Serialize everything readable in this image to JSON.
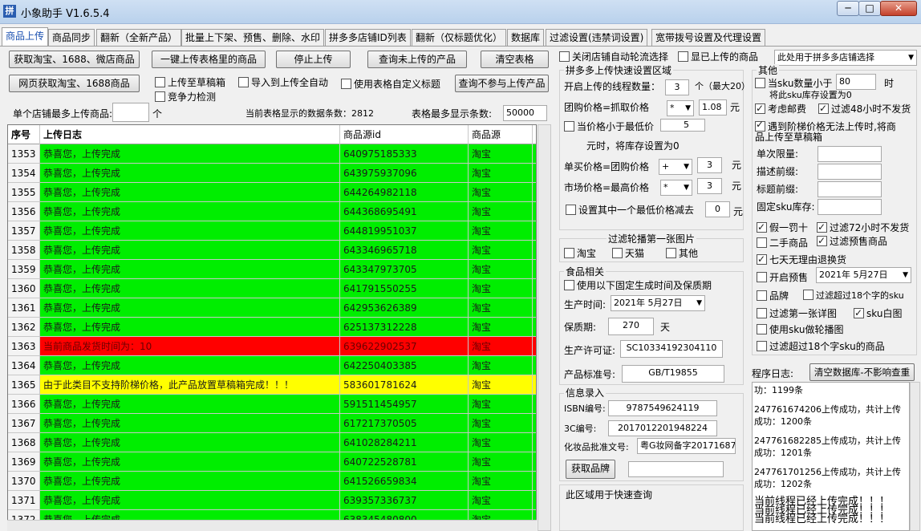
{
  "window": {
    "title": "小象助手 V1.6.5.4",
    "icon_text": "拼",
    "minimize": "─",
    "maximize": "□",
    "close": "✕"
  },
  "tabs": [
    "商品上传",
    "商品同步",
    "翻新（全新产品）",
    "批量上下架、预售、删除、水印",
    "拼多多店铺ID列表",
    "翻新（仅标题优化）",
    "数据库",
    "过滤设置(违禁词设置)",
    "宽带拨号设置及代理设置"
  ],
  "toolbar": {
    "fetch_btn": "获取淘宝、1688、微店商品",
    "upload_table_btn": "一键上传表格里的商品",
    "stop_btn": "停止上传",
    "query_btn": "查询未上传的产品",
    "clear_btn": "清空表格",
    "web_fetch_btn": "网页获取淘宝、1688商品",
    "cb_draft": "上传至草稿箱",
    "cb_import_auto": "导入到上传全自动",
    "cb_custom_title": "使用表格自定义标题",
    "query_excluded_btn": "查询不参与上传产品",
    "cb_compete": "竞争力检测",
    "max_upload_label": "单个店铺最多上传商品:",
    "max_upload_value": "",
    "max_upload_unit": "个",
    "count_label": "当前表格显示的数据条数：2812",
    "max_show_label": "表格最多显示条数:",
    "max_show_value": "50000"
  },
  "right_top": {
    "cb_close_rotate": "关闭店铺自动轮流选择",
    "cb_show_uploaded": "显已上传的商品",
    "shop_select": "此处用于拼多多店铺选择"
  },
  "grid": {
    "headers": [
      "序号",
      "上传日志",
      "商品源id",
      "商品源"
    ],
    "rows": [
      {
        "no": "1353",
        "log": "恭喜您，上传完成",
        "id": "640975185333",
        "src": "淘宝",
        "status": "green"
      },
      {
        "no": "1354",
        "log": "恭喜您，上传完成",
        "id": "643975937096",
        "src": "淘宝",
        "status": "green"
      },
      {
        "no": "1355",
        "log": "恭喜您，上传完成",
        "id": "644264982118",
        "src": "淘宝",
        "status": "green"
      },
      {
        "no": "1356",
        "log": "恭喜您，上传完成",
        "id": "644368695491",
        "src": "淘宝",
        "status": "green"
      },
      {
        "no": "1357",
        "log": "恭喜您，上传完成",
        "id": "644819951037",
        "src": "淘宝",
        "status": "green"
      },
      {
        "no": "1358",
        "log": "恭喜您，上传完成",
        "id": "643346965718",
        "src": "淘宝",
        "status": "green"
      },
      {
        "no": "1359",
        "log": "恭喜您，上传完成",
        "id": "643347973705",
        "src": "淘宝",
        "status": "green"
      },
      {
        "no": "1360",
        "log": "恭喜您，上传完成",
        "id": "641791550255",
        "src": "淘宝",
        "status": "green"
      },
      {
        "no": "1361",
        "log": "恭喜您，上传完成",
        "id": "642953626389",
        "src": "淘宝",
        "status": "green"
      },
      {
        "no": "1362",
        "log": "恭喜您，上传完成",
        "id": "625137312228",
        "src": "淘宝",
        "status": "green"
      },
      {
        "no": "1363",
        "log": "当前商品发货时间为：10",
        "id": "639622902537",
        "src": "淘宝",
        "status": "red"
      },
      {
        "no": "1364",
        "log": "恭喜您，上传完成",
        "id": "642250403385",
        "src": "淘宝",
        "status": "green"
      },
      {
        "no": "1365",
        "log": "由于此类目不支持阶梯价格，此产品放置草稿箱完成！！！",
        "id": "583601781624",
        "src": "淘宝",
        "status": "yellow"
      },
      {
        "no": "1366",
        "log": "恭喜您，上传完成",
        "id": "591511454957",
        "src": "淘宝",
        "status": "green"
      },
      {
        "no": "1367",
        "log": "恭喜您，上传完成",
        "id": "617217370505",
        "src": "淘宝",
        "status": "green"
      },
      {
        "no": "1368",
        "log": "恭喜您，上传完成",
        "id": "641028284211",
        "src": "淘宝",
        "status": "green"
      },
      {
        "no": "1369",
        "log": "恭喜您，上传完成",
        "id": "640722528781",
        "src": "淘宝",
        "status": "green"
      },
      {
        "no": "1370",
        "log": "恭喜您，上传完成",
        "id": "641526659834",
        "src": "淘宝",
        "status": "green"
      },
      {
        "no": "1371",
        "log": "恭喜您，上传完成",
        "id": "639357336737",
        "src": "淘宝",
        "status": "green"
      },
      {
        "no": "1372",
        "log": "恭喜您，上传完成",
        "id": "638345480800",
        "src": "淘宝",
        "status": "green"
      }
    ]
  },
  "quick": {
    "title": "拼多多上传快速设置区域",
    "threads_label": "开启上传的线程数量：",
    "threads_value": "3",
    "threads_hint": "个（最大20）",
    "group_price_label": "团购价格=抓取价格",
    "group_op": "*",
    "group_factor": "1.08",
    "unit_yuan": "元",
    "cb_min_price": "当价格小于最低价",
    "min_price_value": "5",
    "min_price_hint": "元时，将库存设置为0",
    "single_price_label": "单买价格=团购价格",
    "single_op": "+",
    "single_value": "3",
    "market_price_label": "市场价格=最高价格",
    "market_op": "*",
    "market_value": "3",
    "cb_reduce_low": "设置其中一个最低价格减去",
    "reduce_value": "0"
  },
  "carousel": {
    "title": "过滤轮播第一张图片",
    "taobao": "淘宝",
    "tmall": "天猫",
    "other": "其他"
  },
  "food": {
    "title": "食品相关",
    "cb_fixed": "使用以下固定生成时间及保质期",
    "prod_time_label": "生产时间:",
    "prod_time_value": "2021年 5月27日",
    "shelf_label": "保质期:",
    "shelf_value": "270",
    "shelf_unit": "天",
    "license_label": "生产许可证:",
    "license_value": "SC10334192304110",
    "standard_label": "产品标准号:",
    "standard_value": "GB/T19855"
  },
  "info": {
    "title": "信息录入",
    "isbn_label": "ISBN编号:",
    "isbn_value": "9787549624119",
    "ccc_label": "3C编号:",
    "ccc_value": "2017012201948224",
    "cosmetic_label": "化妆品批准文号:",
    "cosmetic_value": "粤G妆网备字20171687",
    "brand_btn": "获取品牌",
    "brand_value": "",
    "quick_query": "此区域用于快速查询"
  },
  "other": {
    "title": "其他",
    "cb_sku_less": "当sku数量小于",
    "sku_less_value": "80",
    "sku_less_unit": "时",
    "sku_less_hint": "将此sku库存设置为0",
    "cb_postage": "考虑邮费",
    "cb_48h": "过滤48小时不发货",
    "cb_ladder": "遇到阶梯价格无法上传时,将商品上传至草稿箱",
    "limit_label": "单次限量:",
    "desc_prefix_label": "描述前缀:",
    "title_prefix_label": "标题前缀:",
    "fixed_stock_label": "固定sku库存:",
    "cb_fake": "假一罚十",
    "cb_72h": "过滤72小时不发货",
    "cb_second_hand": "二手商品",
    "cb_presale": "过滤预售商品",
    "cb_seven_day": "七天无理由退换货",
    "cb_open_presale": "开启预售",
    "presale_date": "2021年 5月27日",
    "cb_brand": "品牌",
    "cb_sku18": "过滤超过18个字的sku",
    "cb_first_detail": "过滤第一张详图",
    "cb_sku_white": "sku白图",
    "cb_sku_carousel": "使用sku做轮播图",
    "cb_sku18_product": "过滤超过18个字sku的商品"
  },
  "log": {
    "label": "程序日志:",
    "clear_btn": "清空数据库-不影响查重",
    "entries": [
      "功：1199条",
      "247761674206上传成功，共计上传成功：1200条",
      "247761682285上传成功，共计上传成功：1201条",
      "247761701256上传成功，共计上传成功：1202条"
    ],
    "done_lines": [
      "当前线程已经上传完成！！！",
      "当前线程已经上传完成！！！",
      "当前线程已经上传完成！！！"
    ]
  }
}
